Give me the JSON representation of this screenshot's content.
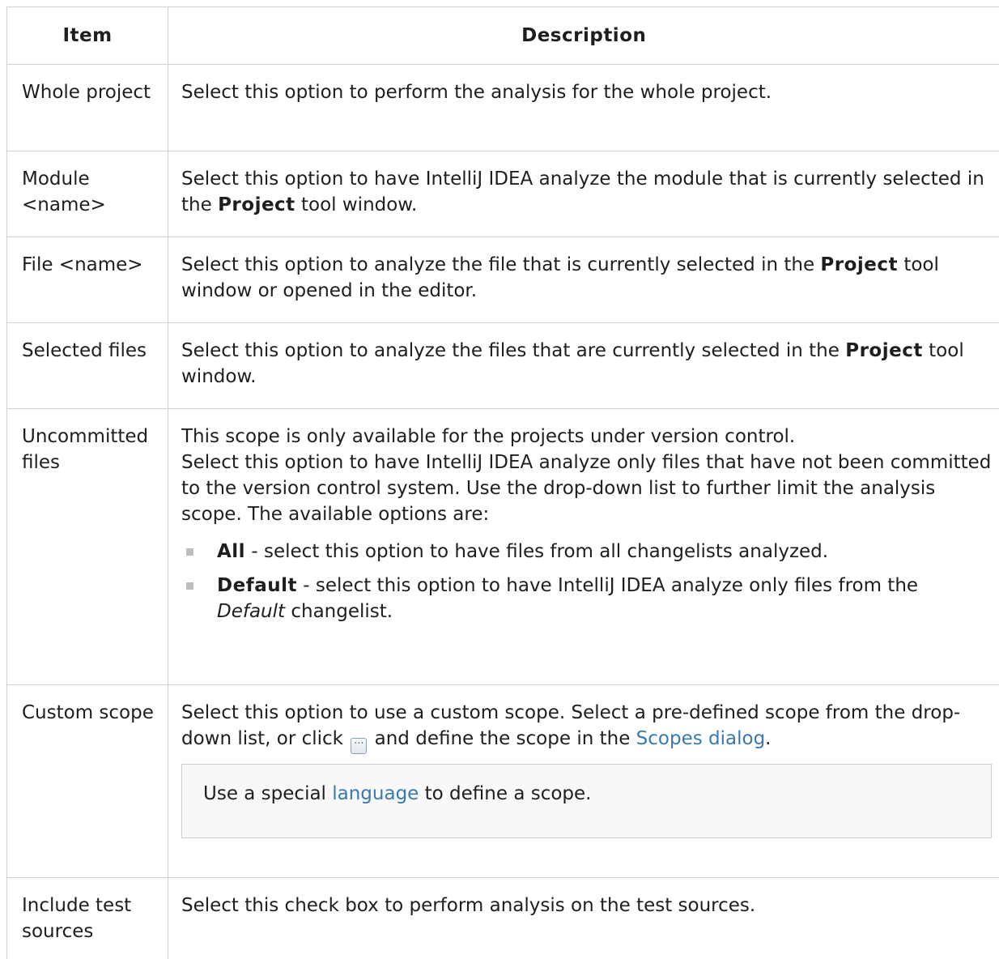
{
  "header": {
    "item": "Item",
    "description": "Description"
  },
  "rows": [
    {
      "item": "Whole project",
      "desc": "Select this option to perform the analysis for the whole project."
    },
    {
      "item": "Module <name>",
      "desc_a": "Select this option to have IntelliJ IDEA analyze the module that is currently selected in the ",
      "desc_bold": "Project",
      "desc_b": " tool window."
    },
    {
      "item": "File <name>",
      "desc_a": "Select this option to analyze the file that is currently selected in the ",
      "desc_bold": "Project",
      "desc_b": " tool window or opened in the editor."
    },
    {
      "item": "Selected files",
      "desc_a": "Select this option to analyze the files that are currently selected in the ",
      "desc_bold": "Project",
      "desc_b": " tool window."
    },
    {
      "item": "Uncommitted files",
      "line1": "This scope is only available for the projects under version control.",
      "line2": "Select this option to have IntelliJ IDEA analyze only files that have not been committed to the version control system. Use the drop-down list to further limit the analysis scope. The available options are:",
      "options": [
        {
          "bold": "All",
          "text": " - select this option to have files from all changelists analyzed."
        },
        {
          "bold": "Default",
          "text": " - select this option to have IntelliJ IDEA analyze only files from the ",
          "italic": "Default",
          "text2": " changelist."
        }
      ]
    },
    {
      "item": "Custom scope",
      "desc_a": "Select this option to use a custom scope. Select a pre-defined scope from the drop-down list, or click ",
      "icon": "ellipsis-button-icon",
      "icon_glyph": "···",
      "desc_b": " and define the scope in the ",
      "link": "Scopes dialog",
      "desc_c": ".",
      "note_a": "Use a special ",
      "note_link": "language",
      "note_b": " to define a scope."
    },
    {
      "item": "Include test sources",
      "desc": "Select this check box to perform analysis on the test sources."
    }
  ]
}
